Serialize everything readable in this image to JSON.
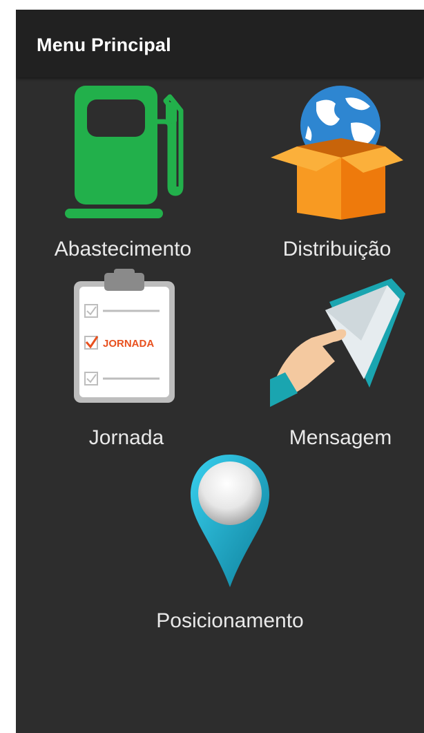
{
  "app_bar": {
    "title": "Menu Principal"
  },
  "menu": {
    "items": [
      {
        "id": "abastecimento",
        "label": "Abastecimento",
        "icon": "fuel-pump-icon"
      },
      {
        "id": "distribuicao",
        "label": "Distribuição",
        "icon": "globe-box-icon"
      },
      {
        "id": "jornada",
        "label": "Jornada",
        "icon": "clipboard-checklist-icon",
        "icon_text": "JORNADA"
      },
      {
        "id": "mensagem",
        "label": "Mensagem",
        "icon": "hand-envelope-icon"
      },
      {
        "id": "posicionamento",
        "label": "Posicionamento",
        "icon": "map-pin-icon"
      }
    ]
  },
  "colors": {
    "screen_background": "#2d2d2d",
    "app_bar_background": "#212121",
    "fuel_green": "#22b04b",
    "box_orange": "#f7931e",
    "checklist_accent": "#e8501e",
    "envelope_teal": "#1aa5b0",
    "pin_blue": "#18a8c8"
  }
}
